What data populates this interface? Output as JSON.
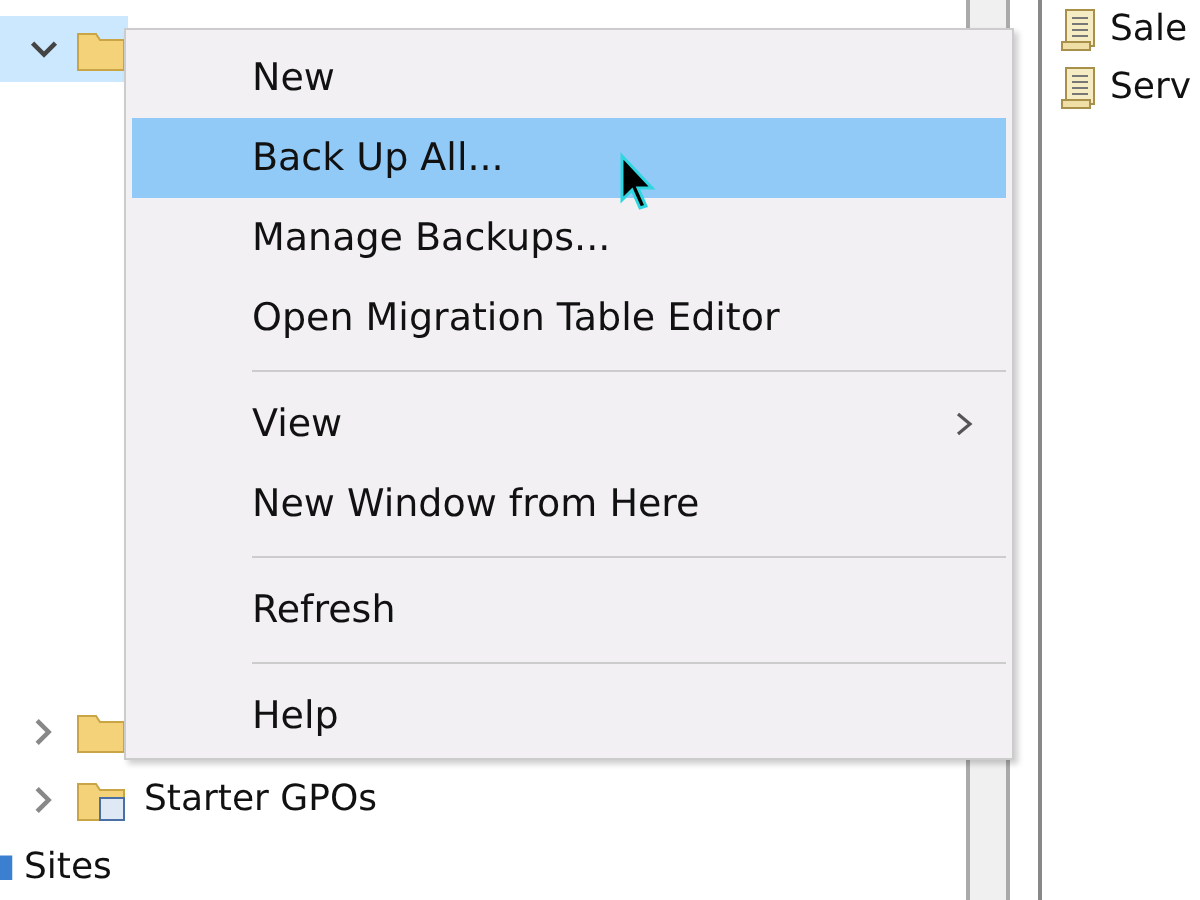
{
  "tree": {
    "rows": [
      {
        "kind": "folder",
        "expanded": true,
        "selected": true
      },
      {
        "kind": "folder",
        "expanded": false,
        "selected": false
      },
      {
        "kind": "gpo-folder",
        "expanded": false,
        "selected": false,
        "label": "Starter GPOs"
      },
      {
        "kind": "site",
        "selected": false,
        "label": "Sites"
      }
    ]
  },
  "context_menu": {
    "items": [
      {
        "kind": "command",
        "label": "New",
        "selected": false
      },
      {
        "kind": "command",
        "label": "Back Up All...",
        "selected": true
      },
      {
        "kind": "command",
        "label": "Manage Backups...",
        "selected": false
      },
      {
        "kind": "command",
        "label": "Open Migration Table Editor",
        "selected": false
      },
      {
        "kind": "separator"
      },
      {
        "kind": "submenu",
        "label": "View",
        "selected": false
      },
      {
        "kind": "command",
        "label": "New Window from Here",
        "selected": false
      },
      {
        "kind": "separator"
      },
      {
        "kind": "command",
        "label": "Refresh",
        "selected": false
      },
      {
        "kind": "separator"
      },
      {
        "kind": "command",
        "label": "Help",
        "selected": false
      }
    ]
  },
  "right_pane": {
    "items": [
      {
        "label": "Sale"
      },
      {
        "label": "Serv"
      }
    ]
  }
}
